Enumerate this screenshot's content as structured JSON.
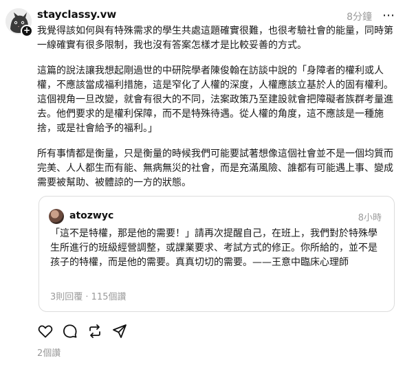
{
  "post": {
    "username": "stayclassy.vw",
    "time": "8分鐘",
    "more_label": "⋯",
    "avatar_icon": "cat-avatar-icon",
    "paragraphs": [
      "我覺得該如何與有特殊需求的學生共處這題確實很難，也很考驗社會的能量，同時第一線確實有很多限制，我也沒有答案怎樣才是比較妥善的方式。",
      "這篇的說法讓我想起剛過世的中研院學者陳俊翰在訪談中說的「身障者的權利或人權，不應該當成福利措施，這是窄化了人權的深度，人權應該立基於人的固有權利。這個視角一旦改變，就會有很大的不同，法案政策乃至建設就會把障礙者族群考量進去。他們要求的是權利保障，而不是特殊待遇。從人權的角度，這不應該是一種施捨，或是社會給予的福利。」",
      "所有事情都是衡量，只是衡量的時候我們可能要試著想像這個社會並不是一個均質而完美、人人都生而有能、無病無災的社會，而是充滿風險、誰都有可能遇上事、變成需要被幫助、被體諒的一方的狀態。"
    ]
  },
  "quote": {
    "username": "atozwyc",
    "time": "8小時",
    "body": "「這不是特權，那是他的需要！」請再次提醒自己，在班上，我們對於特殊學生所進行的班級經營調整，或課業要求、考試方式的修正。你所給的，並不是孩子的特權，而是他的需要。真真切切的需要。——王意中臨床心理師",
    "stats": "3則回覆 · 115個讚"
  },
  "actions": {
    "icons": [
      "heart-icon",
      "comment-icon",
      "repost-icon",
      "share-icon"
    ]
  },
  "footer": {
    "replies": "2個讚"
  }
}
